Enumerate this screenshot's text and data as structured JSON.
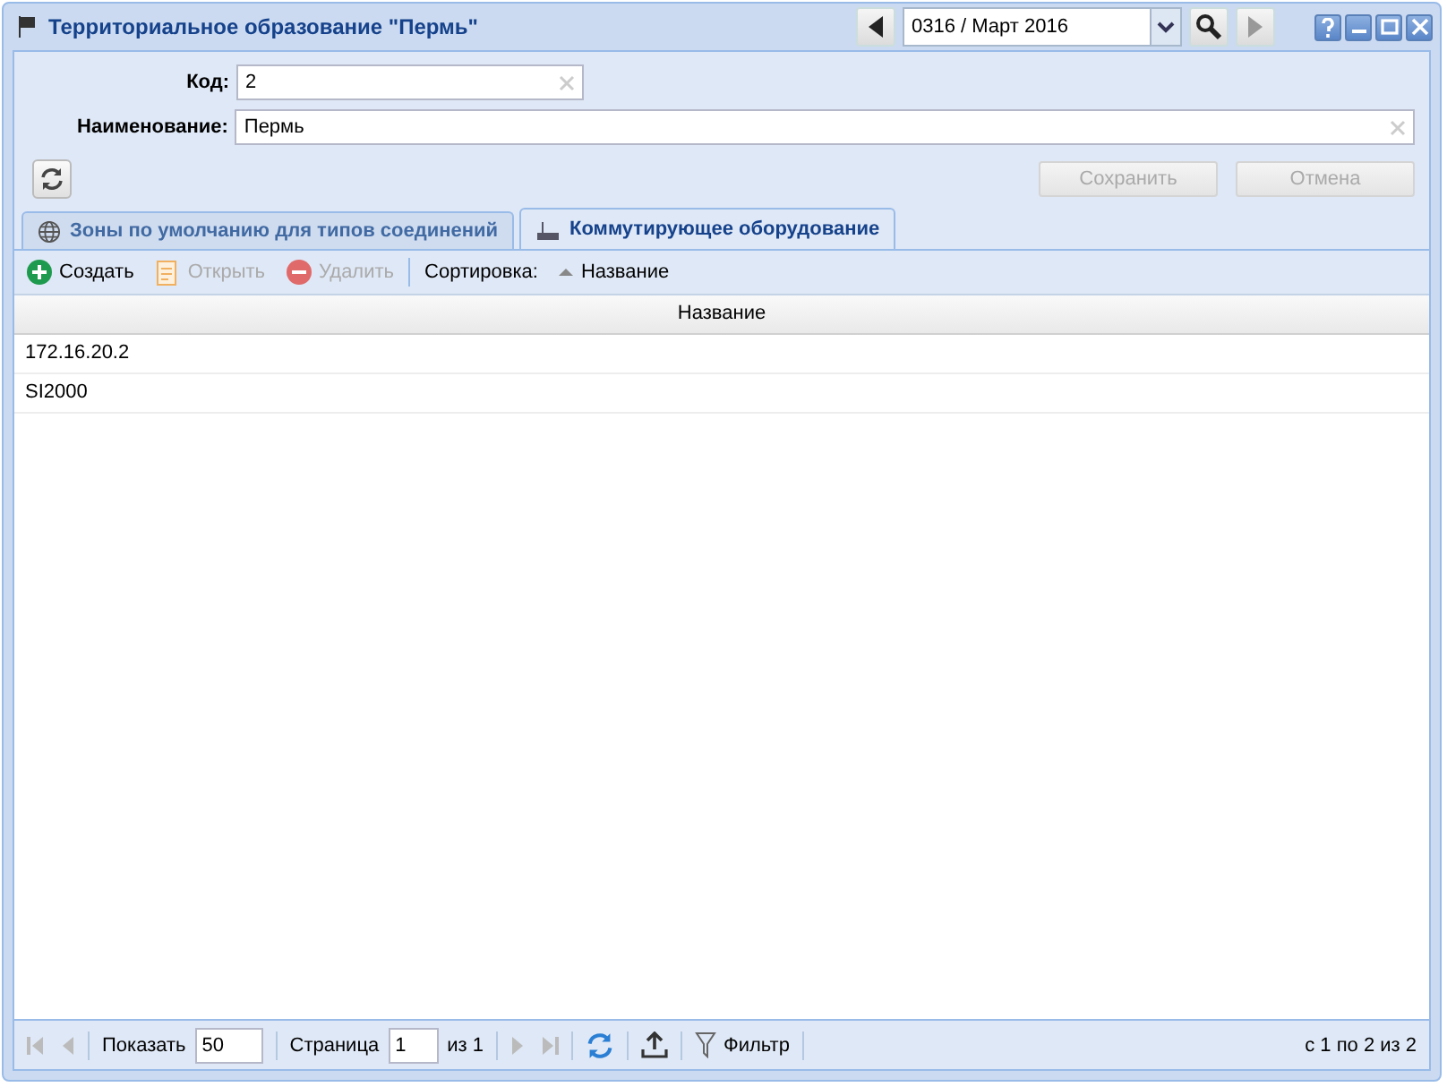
{
  "window": {
    "title": "Территориальное образование \"Пермь\""
  },
  "period": {
    "value": "0316 / Март 2016"
  },
  "fields": [
    {
      "label": "Код:",
      "value": "2",
      "kind": "short"
    },
    {
      "label": "Наименование:",
      "value": "Пермь",
      "kind": "wide"
    }
  ],
  "buttons": [
    {
      "label": "Сохранить",
      "disabled": true
    },
    {
      "label": "Отмена",
      "disabled": true
    }
  ],
  "tabs": [
    {
      "label": "Зоны по умолчанию для типов соединений",
      "selected": false,
      "kind": "globe"
    },
    {
      "label": "Коммутирующее оборудование",
      "selected": true,
      "kind": "device"
    }
  ],
  "toolbar": [
    {
      "kind": "create",
      "label": "Создать",
      "disabled": false
    },
    {
      "kind": "open",
      "label": "Открыть",
      "disabled": true
    },
    {
      "kind": "delete",
      "label": "Удалить",
      "disabled": true
    }
  ],
  "sort": {
    "label": "Сортировка:",
    "field": "Название"
  },
  "table": {
    "columns": [
      "Название"
    ],
    "rows": [
      [
        "172.16.20.2"
      ],
      [
        "SI2000"
      ]
    ]
  },
  "pager": {
    "show_label": "Показать",
    "page_size": "50",
    "page_label": "Страница",
    "page": "1",
    "of": "из 1",
    "filter": "Фильтр",
    "info": "с 1 по 2 из 2"
  }
}
